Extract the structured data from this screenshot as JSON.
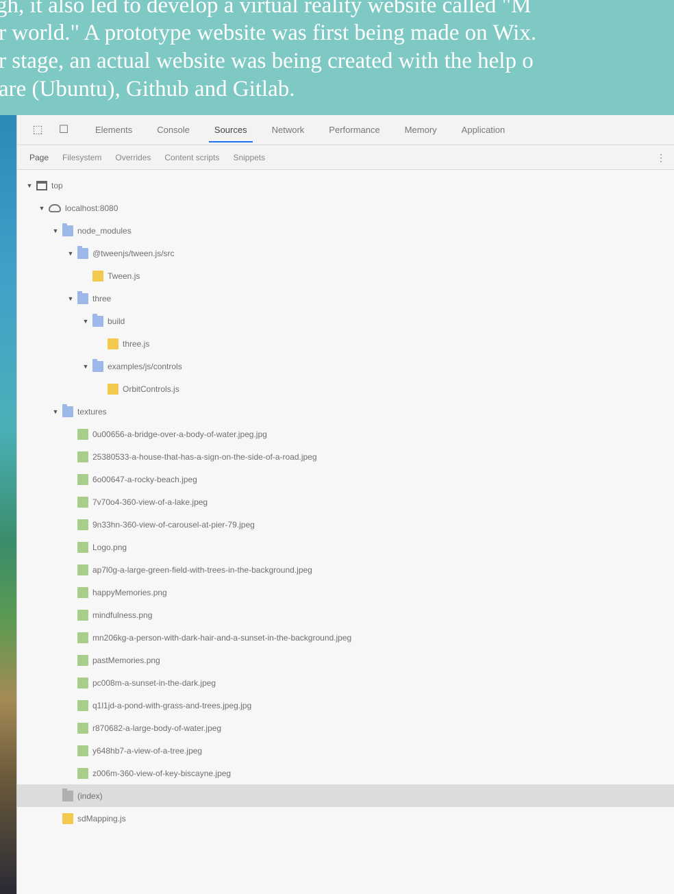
{
  "banner": {
    "lines": [
      "gh, it also led to develop a virtual reality website called \"M",
      "r world.\" A prototype website was first being made on Wix.",
      "r stage, an actual website was being created with the help o",
      "are (Ubuntu), Github and Gitlab."
    ]
  },
  "devtools": {
    "tabs": [
      "Elements",
      "Console",
      "Sources",
      "Network",
      "Performance",
      "Memory",
      "Application"
    ],
    "active_tab": "Sources",
    "subtabs": [
      "Page",
      "Filesystem",
      "Overrides",
      "Content scripts",
      "Snippets"
    ],
    "active_subtab": "Page",
    "tree": [
      {
        "label": "top",
        "caret": "▼",
        "icon": "frame",
        "indent": 0
      },
      {
        "label": "localhost:8080",
        "caret": "▼",
        "icon": "cloud",
        "indent": 1
      },
      {
        "label": "node_modules",
        "caret": "▼",
        "icon": "folder",
        "indent": 2
      },
      {
        "label": "@tweenjs/tween.js/src",
        "caret": "▼",
        "icon": "folder",
        "indent": 3
      },
      {
        "label": "Tween.js",
        "caret": "",
        "icon": "file-js",
        "indent": 4
      },
      {
        "label": "three",
        "caret": "▼",
        "icon": "folder",
        "indent": 3
      },
      {
        "label": "build",
        "caret": "▼",
        "icon": "folder",
        "indent": 4
      },
      {
        "label": "three.js",
        "caret": "",
        "icon": "file-js",
        "indent": 5
      },
      {
        "label": "examples/js/controls",
        "caret": "▼",
        "icon": "folder",
        "indent": 4
      },
      {
        "label": "OrbitControls.js",
        "caret": "",
        "icon": "file-js",
        "indent": 5
      },
      {
        "label": "textures",
        "caret": "▼",
        "icon": "folder",
        "indent": 2
      },
      {
        "label": "0u00656-a-bridge-over-a-body-of-water.jpeg.jpg",
        "caret": "",
        "icon": "file-img",
        "indent": 3
      },
      {
        "label": "25380533-a-house-that-has-a-sign-on-the-side-of-a-road.jpeg",
        "caret": "",
        "icon": "file-img",
        "indent": 3
      },
      {
        "label": "6o00647-a-rocky-beach.jpeg",
        "caret": "",
        "icon": "file-img",
        "indent": 3
      },
      {
        "label": "7v70o4-360-view-of-a-lake.jpeg",
        "caret": "",
        "icon": "file-img",
        "indent": 3
      },
      {
        "label": "9n33hn-360-view-of-carousel-at-pier-79.jpeg",
        "caret": "",
        "icon": "file-img",
        "indent": 3
      },
      {
        "label": "Logo.png",
        "caret": "",
        "icon": "file-img",
        "indent": 3
      },
      {
        "label": "ap7l0g-a-large-green-field-with-trees-in-the-background.jpeg",
        "caret": "",
        "icon": "file-img",
        "indent": 3
      },
      {
        "label": "happyMemories.png",
        "caret": "",
        "icon": "file-img",
        "indent": 3
      },
      {
        "label": "mindfulness.png",
        "caret": "",
        "icon": "file-img",
        "indent": 3
      },
      {
        "label": "mn206kg-a-person-with-dark-hair-and-a-sunset-in-the-background.jpeg",
        "caret": "",
        "icon": "file-img",
        "indent": 3
      },
      {
        "label": "pastMemories.png",
        "caret": "",
        "icon": "file-img",
        "indent": 3
      },
      {
        "label": "pc008m-a-sunset-in-the-dark.jpeg",
        "caret": "",
        "icon": "file-img",
        "indent": 3
      },
      {
        "label": "q1l1jd-a-pond-with-grass-and-trees.jpeg.jpg",
        "caret": "",
        "icon": "file-img",
        "indent": 3
      },
      {
        "label": "r870682-a-large-body-of-water.jpeg",
        "caret": "",
        "icon": "file-img",
        "indent": 3
      },
      {
        "label": "y648hb7-a-view-of-a-tree.jpeg",
        "caret": "",
        "icon": "file-img",
        "indent": 3
      },
      {
        "label": "z006m-360-view-of-key-biscayne.jpeg",
        "caret": "",
        "icon": "file-img",
        "indent": 3
      },
      {
        "label": "(index)",
        "caret": "",
        "icon": "folder-gray",
        "indent": 2,
        "selected": true
      },
      {
        "label": "sdMapping.js",
        "caret": "",
        "icon": "file-js",
        "indent": 2
      }
    ]
  }
}
